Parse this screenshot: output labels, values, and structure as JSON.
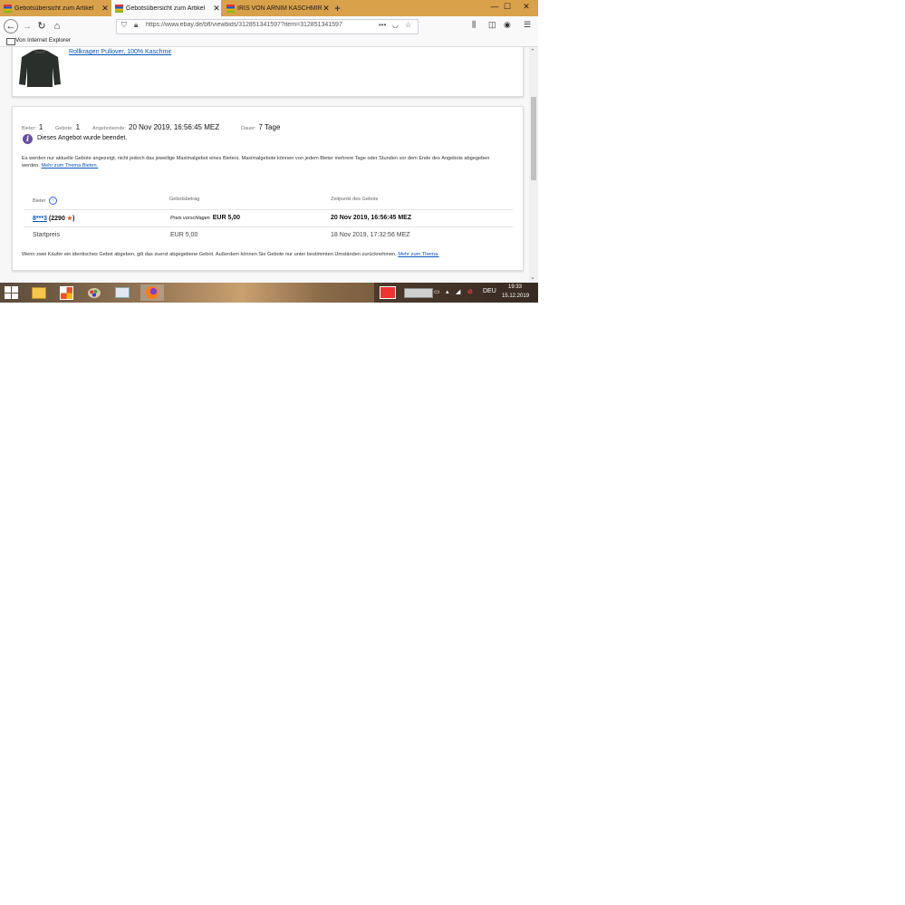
{
  "tabs": [
    {
      "label": "Gebotsübersicht zum Artikel",
      "active": false
    },
    {
      "label": "Gebotsübersicht zum Artikel",
      "active": true
    },
    {
      "label": "IRIS VON ARNIM KASCHMIR R",
      "active": false
    }
  ],
  "window": {
    "minimize": "—",
    "maximize": "☐",
    "close": "✕"
  },
  "nav": {
    "url": "https://www.ebay.de/bfl/viewbids/312851341597?item=312851341597",
    "more": "•••"
  },
  "bookmarks": {
    "item": "Von Internet Explorer"
  },
  "item": {
    "title": "Rollkragen Pullover, 100% Kaschmir"
  },
  "stats": {
    "bidders_label": "Bieter:",
    "bidders_value": "1",
    "bids_label": "Gebote:",
    "bids_value": "1",
    "end_label": "Angebotsende:",
    "end_value": "20 Nov 2019, 16:56:45 MEZ",
    "duration_label": "Dauer:",
    "duration_value": "7 Tage"
  },
  "status": {
    "ended": "Dieses Angebot wurde beendet."
  },
  "info": {
    "text": "Es werden nur aktuelle Gebote angezeigt, nicht jedoch das jeweilige Maximalgebot eines Bieters. Maximalgebote können von jedem Bieter mehrere Tage oder Stunden vor dem Ende des Angebots abgegeben werden.",
    "link": "Mehr zum Thema Bieten."
  },
  "table": {
    "headers": [
      "Bieter",
      "Gebotsbetrag",
      "Zeitpunkt des Gebots"
    ],
    "rows": [
      {
        "bidder": "8***3",
        "score": "2290",
        "bid_label": "Preis vorschlagen",
        "amount": "EUR 5,00",
        "time": "20 Nov 2019, 16:56:45 MEZ"
      },
      {
        "bidder": "Startpreis",
        "amount": "EUR 5,00",
        "time": "18 Nov 2019, 17:32:56 MEZ"
      }
    ]
  },
  "footnote": {
    "text": "Wenn zwei Käufer ein identisches Gebot abgeben, gilt das zuerst abgegebene Gebot. Außerdem können Sie Gebote nur unter bestimmten Umständen zurücknehmen.",
    "link": "Mehr zum Thema."
  },
  "taskbar": {
    "lang": "DEU",
    "time": "19:33",
    "date": "15.12.2019"
  }
}
